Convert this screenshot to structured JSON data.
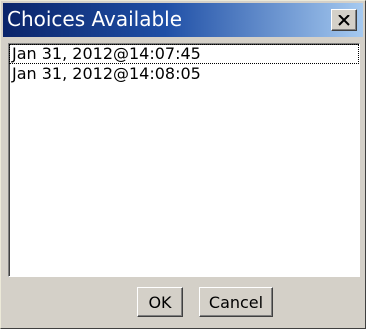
{
  "window": {
    "title": "Choices Available",
    "close_icon": "close-x-icon"
  },
  "list": {
    "items": [
      {
        "label": "Jan 31, 2012@14:07:45",
        "focused": true
      },
      {
        "label": "Jan 31, 2012@14:08:05",
        "focused": false
      }
    ]
  },
  "buttons": {
    "ok_label": "OK",
    "cancel_label": "Cancel"
  },
  "colors": {
    "title_gradient_start": "#0a246a",
    "title_gradient_end": "#a6caf0",
    "face": "#d4d0c8"
  }
}
